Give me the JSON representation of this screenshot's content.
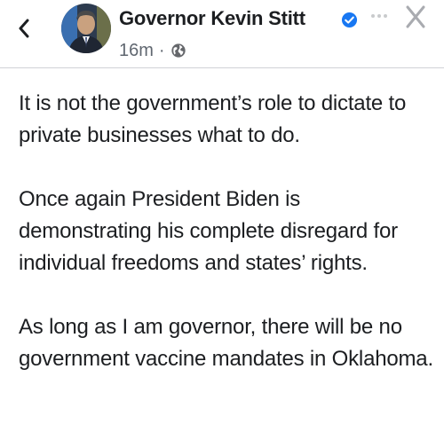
{
  "header": {
    "author_name": "Governor Kevin Stitt",
    "timestamp": "16m",
    "separator": "·",
    "verified_color": "#1877f2",
    "icons": {
      "back": "chevron-left-icon",
      "verified": "verified-badge-icon",
      "privacy": "globe-icon",
      "more": "more-options-icon",
      "close": "close-icon"
    }
  },
  "post": {
    "paragraphs": [
      "It is not the government’s role to dictate to private businesses what to do.",
      "Once again President Biden is demonstrating his complete disregard for individual freedoms and states’ rights.",
      "As long as I am governor, there will be no government vaccine mandates in Oklahoma."
    ]
  }
}
